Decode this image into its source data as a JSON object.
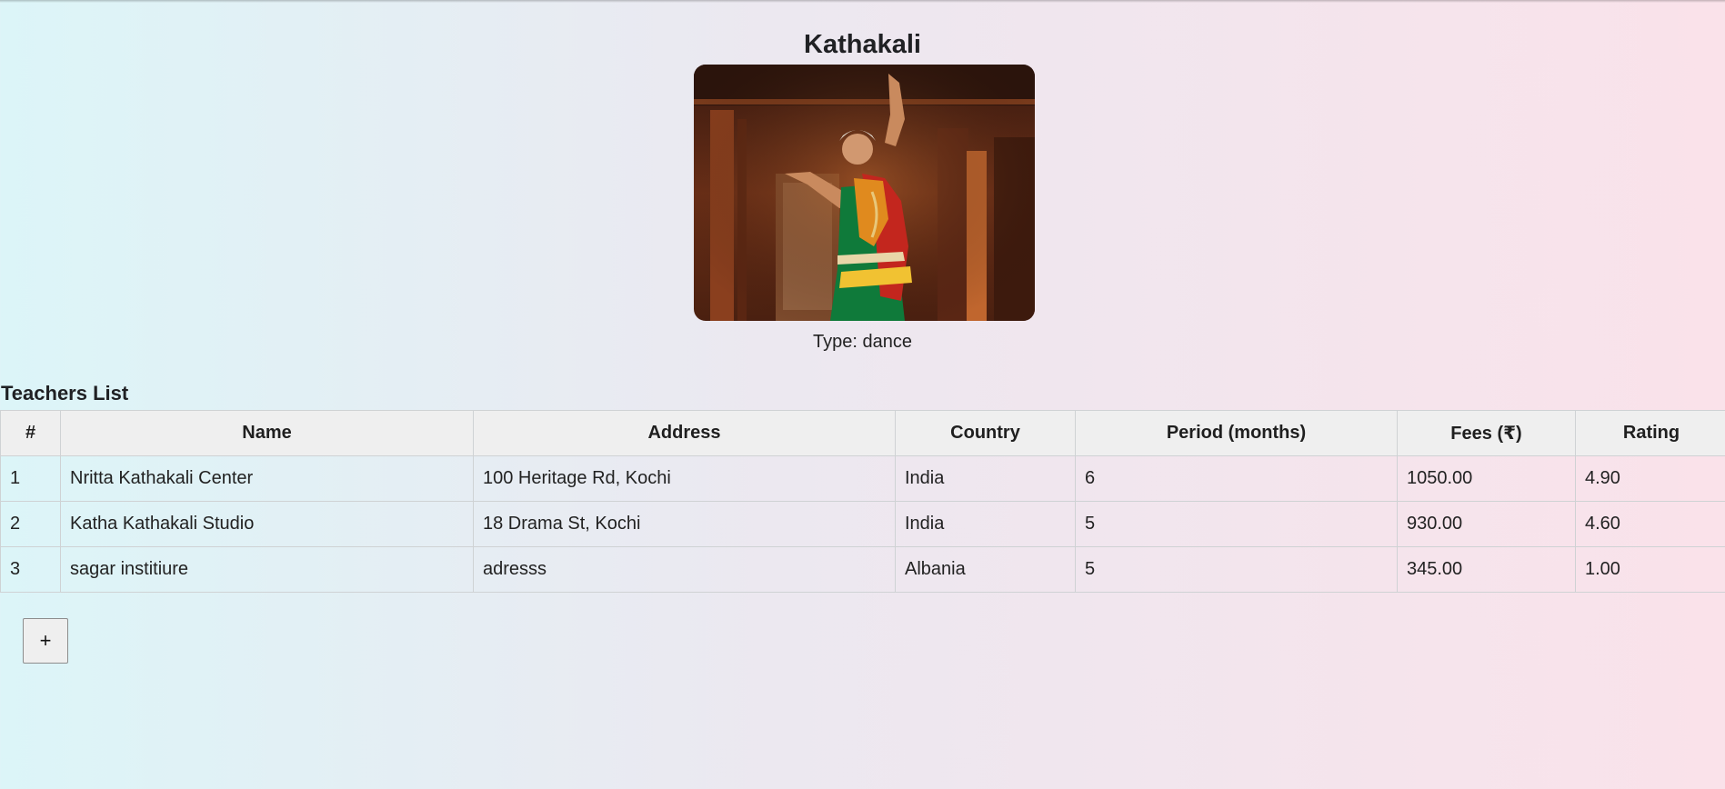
{
  "art": {
    "title": "Kathakali",
    "type_label": "Type:",
    "type_value": "dance"
  },
  "teachers": {
    "heading": "Teachers List",
    "columns": [
      "#",
      "Name",
      "Address",
      "Country",
      "Period (months)",
      "Fees (₹)",
      "Rating"
    ],
    "rows": [
      [
        "1",
        "Nritta Kathakali Center",
        "100 Heritage Rd, Kochi",
        "India",
        "6",
        "1050.00",
        "4.90"
      ],
      [
        "2",
        "Katha Kathakali Studio",
        "18 Drama St, Kochi",
        "India",
        "5",
        "930.00",
        "4.60"
      ],
      [
        "3",
        "sagar institiure",
        "adresss",
        "Albania",
        "5",
        "345.00",
        "1.00"
      ]
    ],
    "add_button_label": "+"
  }
}
